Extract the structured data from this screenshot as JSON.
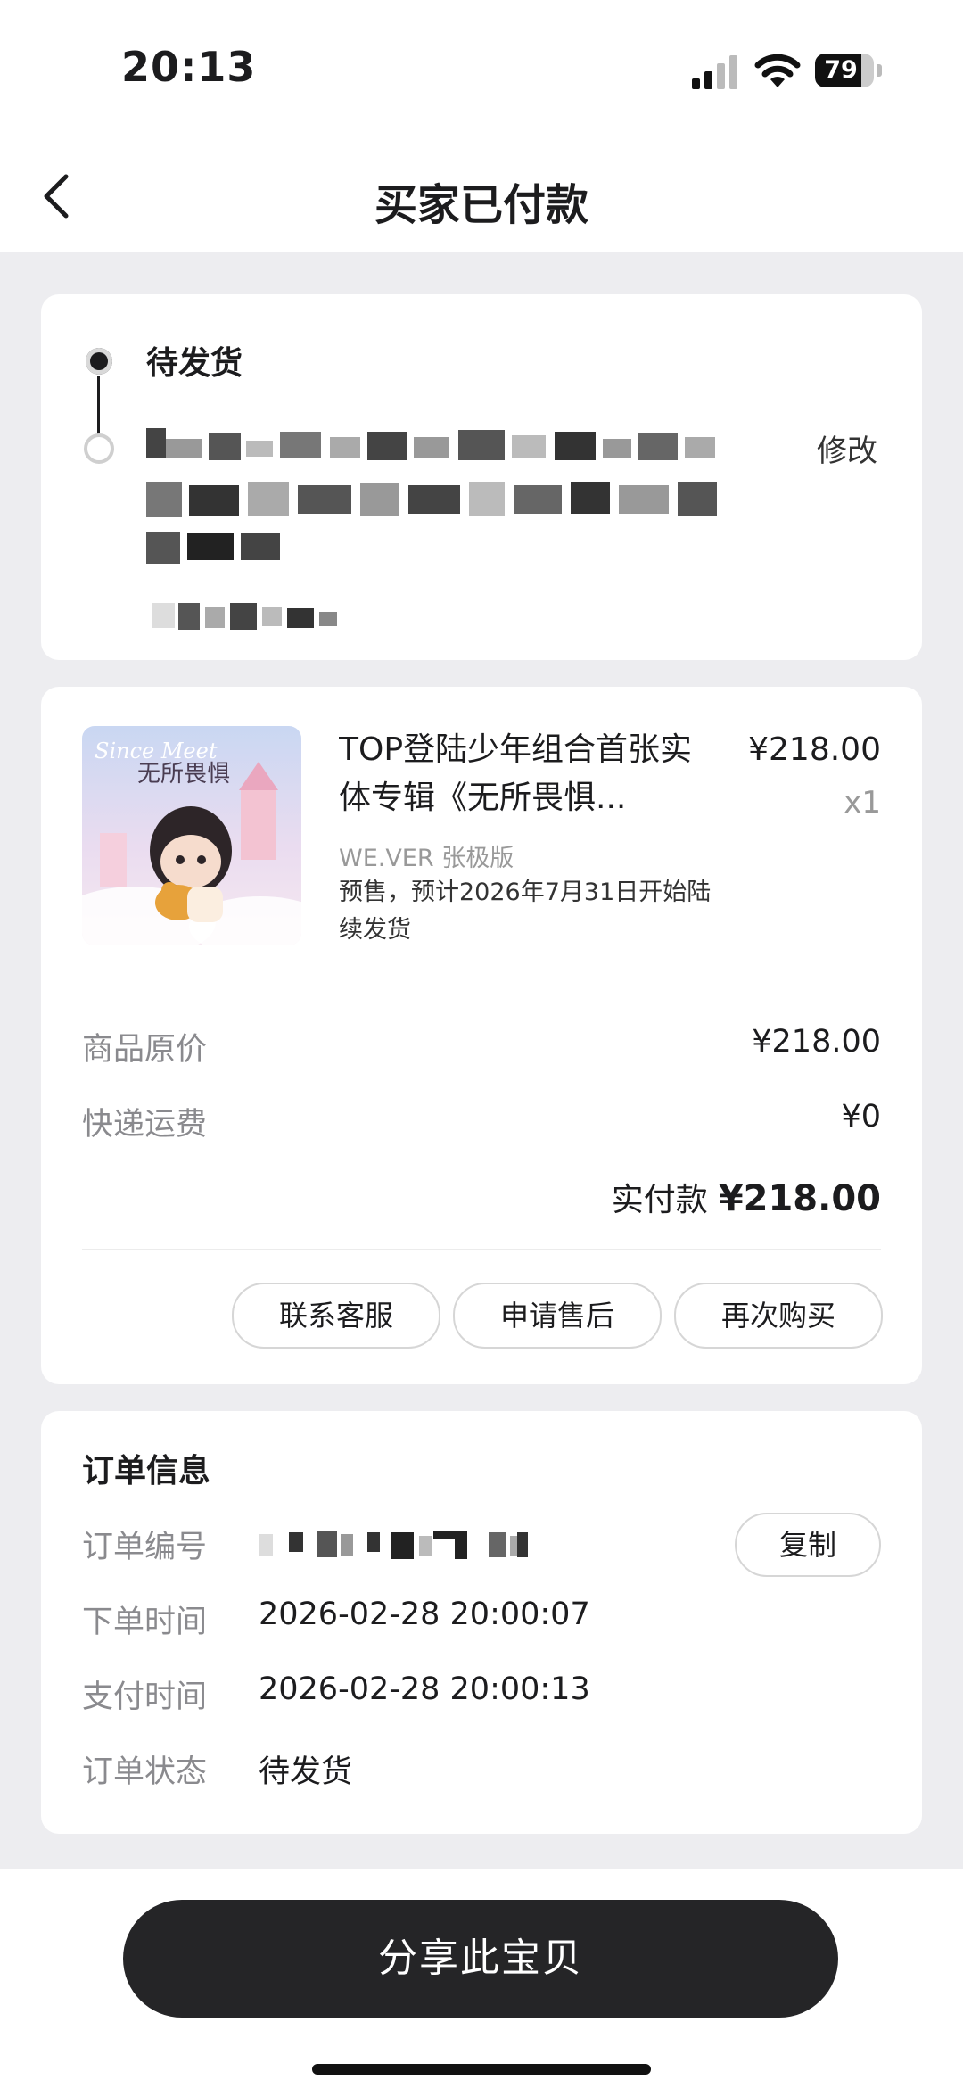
{
  "status_bar": {
    "time": "20:13",
    "battery": "79",
    "battery_level": 0.79
  },
  "nav": {
    "title": "买家已付款"
  },
  "status_card": {
    "current_status": "待发货",
    "modify_label": "修改"
  },
  "product": {
    "title": "TOP登陆少年组合首张实体专辑《无所畏惧...",
    "price": "¥218.00",
    "qty": "x1",
    "variant": "WE.VER 张极版",
    "presale_note": "预售，预计2026年7月31日开始陆续发货",
    "thumb_text_top": "Since Meet",
    "thumb_text_cn": "无所畏惧"
  },
  "summary": {
    "original_price_label": "商品原价",
    "original_price": "¥218.00",
    "shipping_label": "快递运费",
    "shipping": "¥0",
    "paid_label": "实付款",
    "paid_amount": "¥218.00"
  },
  "actions": {
    "contact": "联系客服",
    "after_sale": "申请售后",
    "rebuy": "再次购买"
  },
  "order_info": {
    "heading": "订单信息",
    "number_label": "订单编号",
    "copy_label": "复制",
    "placed_label": "下单时间",
    "placed_time": "2026-02-28 20:00:07",
    "paid_label": "支付时间",
    "paid_time": "2026-02-28 20:00:13",
    "status_label": "订单状态",
    "status": "待发货"
  },
  "bottom": {
    "share_label": "分享此宝贝"
  },
  "colors": {
    "accent_dark": "#252527",
    "page_bg": "#ededf0",
    "muted": "#8a8a8e"
  }
}
